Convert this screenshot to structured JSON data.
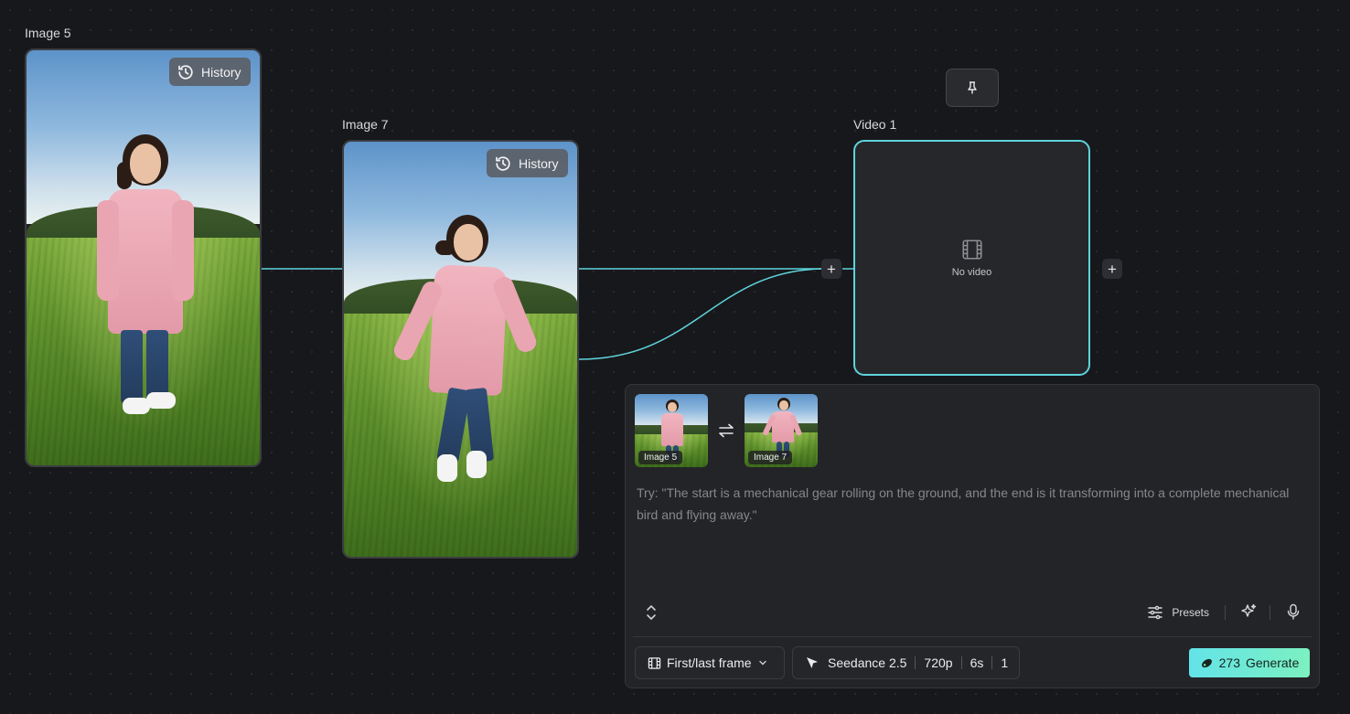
{
  "nodes": {
    "image5": {
      "label": "Image 5",
      "history_label": "History"
    },
    "image7": {
      "label": "Image 7",
      "history_label": "History"
    },
    "video1": {
      "label": "Video 1",
      "empty_text": "No video"
    }
  },
  "handles": {
    "plus": "+"
  },
  "panel": {
    "thumbnails": [
      {
        "label": "Image 5"
      },
      {
        "label": "Image 7"
      }
    ],
    "prompt_placeholder": "Try: \"The start is a mechanical gear rolling on the ground, and the end is it transforming into a complete mechanical bird and flying away.\"",
    "presets_label": "Presets",
    "mode_label": "First/last frame",
    "model": {
      "name": "Seedance 2.5",
      "resolution": "720p",
      "duration": "6s",
      "count": "1"
    },
    "generate": {
      "credits": "273",
      "label": "Generate"
    }
  },
  "icons": {
    "history": "history-icon",
    "pin": "pin-icon",
    "film": "film-icon",
    "swap": "swap-icon",
    "expand": "expand-icon",
    "sliders": "sliders-icon",
    "sparkle": "sparkle-icon",
    "mic": "mic-icon",
    "chevron": "chevron-down-icon",
    "model": "seedance-logo-icon",
    "credits": "credits-icon"
  },
  "colors": {
    "connector": "#5fd3dc",
    "video_border": "#5fd3dc",
    "generate_start": "#63e3e8",
    "generate_end": "#7cf0c0",
    "canvas_bg": "#17181b"
  }
}
